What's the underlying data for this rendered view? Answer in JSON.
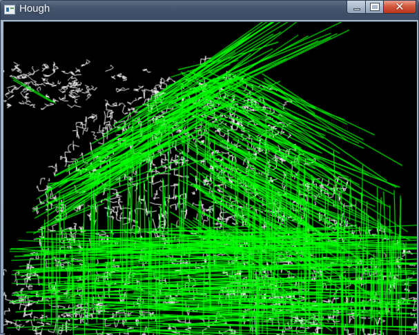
{
  "window": {
    "title": "Hough",
    "app_icon": "opencv-window-icon"
  },
  "caption_buttons": {
    "minimize_icon": "minimize-icon",
    "maximize_icon": "maximize-icon",
    "close_icon": "close-icon",
    "close_glyph": "✕"
  },
  "image": {
    "content": "canny-edges-with-hough-lines",
    "background_color": "#000000",
    "edge_color": "#ffffff",
    "line_color": "#00ff00"
  }
}
